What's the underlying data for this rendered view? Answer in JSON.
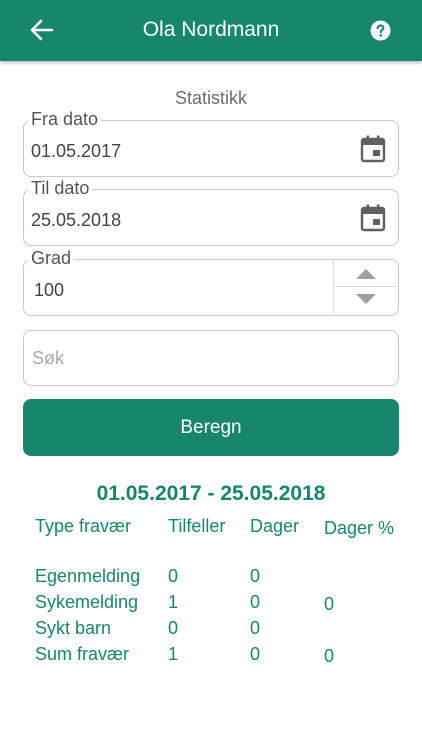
{
  "header": {
    "title": "Ola Nordmann",
    "back_icon": "arrow-left-icon",
    "help_icon": "help-circle-icon",
    "background_color": "#17866d"
  },
  "section_title": "Statistikk",
  "from_date": {
    "label": "Fra dato",
    "value": "01.05.2017",
    "icon": "calendar-icon"
  },
  "to_date": {
    "label": "Til dato",
    "value": "25.05.2018",
    "icon": "calendar-icon"
  },
  "grade": {
    "label": "Grad",
    "value": "100"
  },
  "search": {
    "placeholder": "Søk",
    "value": ""
  },
  "calculate_button": {
    "label": "Beregn"
  },
  "result": {
    "range": "01.05.2017 - 25.05.2018",
    "headers": [
      "Type fravær",
      "Tilfeller",
      "Dager",
      "Dager %"
    ],
    "rows": [
      [
        "Egenmelding",
        "0",
        "0",
        ""
      ],
      [
        "Sykemelding",
        "1",
        "0",
        "0"
      ],
      [
        "Sykt barn",
        "0",
        "0",
        ""
      ],
      [
        "Sum fravær",
        "1",
        "0",
        "0"
      ]
    ]
  }
}
